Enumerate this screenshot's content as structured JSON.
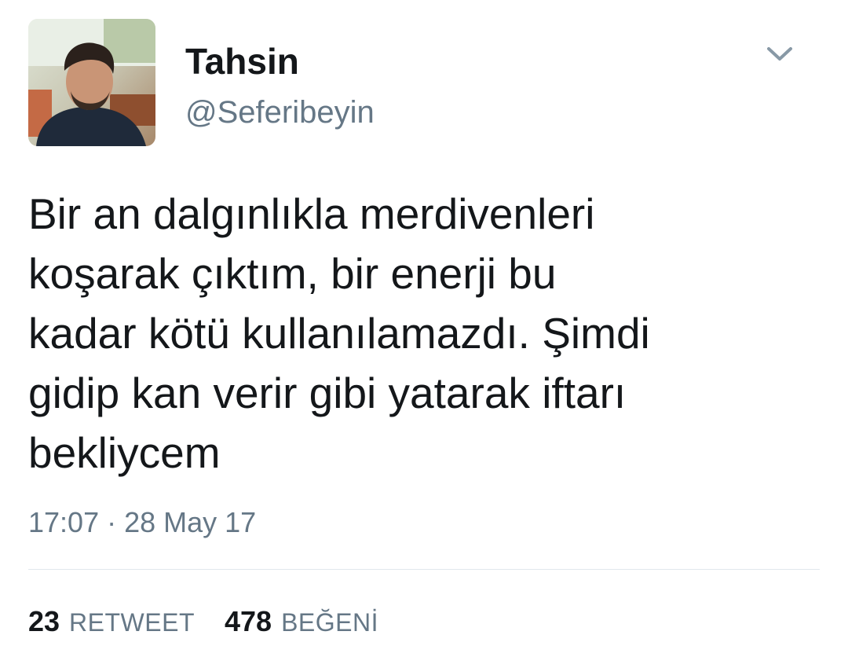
{
  "tweet": {
    "author": {
      "display_name": "Tahsin",
      "handle": "@Seferibeyin",
      "avatar": "avatar-photo"
    },
    "menu_icon": "chevron-down-icon",
    "text": "Bir an dalgınlıkla merdivenleri\nkoşarak çıktım, bir enerji bu\nkadar kötü kullanılamazdı. Şimdi\ngidip kan verir gibi yatarak iftarı\nbekliycem",
    "timestamp": "17:07 · 28 May 17",
    "stats": {
      "retweets": {
        "count": "23",
        "label": "RETWEET"
      },
      "likes": {
        "count": "478",
        "label": "BEĞENİ"
      }
    }
  },
  "colors": {
    "text_primary": "#14171a",
    "text_secondary": "#657786",
    "divider": "#e1e8ed"
  }
}
